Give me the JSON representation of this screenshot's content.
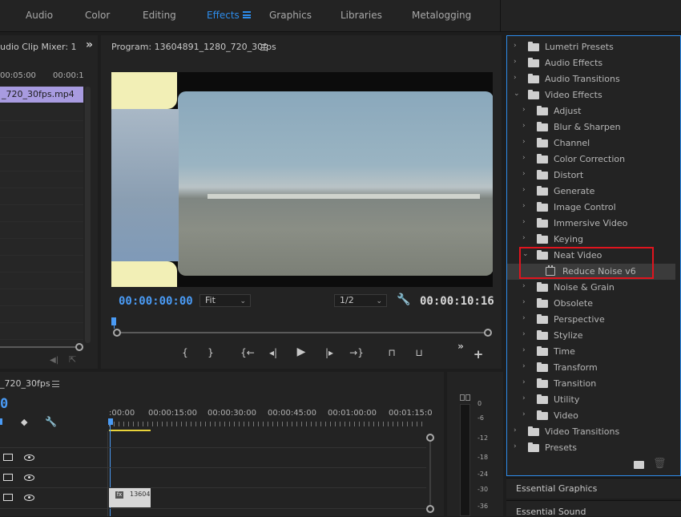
{
  "workspaces": {
    "audio": "Audio",
    "color": "Color",
    "editing": "Editing",
    "effects": "Effects",
    "graphics": "Graphics",
    "libraries": "Libraries",
    "metalogging": "Metalogging"
  },
  "audio_mixer": {
    "title": "udio Clip Mixer: 1",
    "expand_glyph": "»",
    "ruler": [
      "00:05:00",
      "00:00:1"
    ],
    "clip_label": "_720_30fps.mp4"
  },
  "program_monitor": {
    "title": "Program: 13604891_1280_720_30fps",
    "current_timecode": "00:00:00:00",
    "fit_label": "Fit",
    "resolution_label": "1/2",
    "duration_timecode": "00:00:10:16",
    "transport": {
      "mark_in": "{",
      "mark_out": "}",
      "go_to_in": "{←",
      "step_back": "◂|",
      "play": "▶",
      "step_forward": "|▸",
      "go_to_out": "→}",
      "lift": "⊓",
      "extract": "⊔",
      "more": "»",
      "add": "+"
    }
  },
  "timeline": {
    "title": "_720_30fps",
    "timecode_fragment": "0",
    "ruler": [
      ":00:00",
      "00:00:15:00",
      "00:00:30:00",
      "00:00:45:00",
      "00:01:00:00",
      "00:01:15:0"
    ],
    "clip_label": "13604"
  },
  "audio_meter": {
    "labels": [
      "0",
      "-6",
      "-12",
      "-18",
      "-24",
      "-30",
      "-36"
    ]
  },
  "effects_panel": {
    "items": [
      {
        "label": "Lumetri Presets",
        "level": 0,
        "expanded": false,
        "preset": true
      },
      {
        "label": "Audio Effects",
        "level": 0,
        "expanded": false
      },
      {
        "label": "Audio Transitions",
        "level": 0,
        "expanded": false
      },
      {
        "label": "Video Effects",
        "level": 0,
        "expanded": true
      },
      {
        "label": "Adjust",
        "level": 1,
        "expanded": false
      },
      {
        "label": "Blur & Sharpen",
        "level": 1,
        "expanded": false
      },
      {
        "label": "Channel",
        "level": 1,
        "expanded": false
      },
      {
        "label": "Color Correction",
        "level": 1,
        "expanded": false
      },
      {
        "label": "Distort",
        "level": 1,
        "expanded": false
      },
      {
        "label": "Generate",
        "level": 1,
        "expanded": false
      },
      {
        "label": "Image Control",
        "level": 1,
        "expanded": false
      },
      {
        "label": "Immersive Video",
        "level": 1,
        "expanded": false
      },
      {
        "label": "Keying",
        "level": 1,
        "expanded": false
      },
      {
        "label": "Neat Video",
        "level": 1,
        "expanded": true
      },
      {
        "label": "Reduce Noise v6",
        "level": 2,
        "effect": true,
        "selected": true
      },
      {
        "label": "Noise & Grain",
        "level": 1,
        "expanded": false
      },
      {
        "label": "Obsolete",
        "level": 1,
        "expanded": false
      },
      {
        "label": "Perspective",
        "level": 1,
        "expanded": false
      },
      {
        "label": "Stylize",
        "level": 1,
        "expanded": false
      },
      {
        "label": "Time",
        "level": 1,
        "expanded": false
      },
      {
        "label": "Transform",
        "level": 1,
        "expanded": false
      },
      {
        "label": "Transition",
        "level": 1,
        "expanded": false
      },
      {
        "label": "Utility",
        "level": 1,
        "expanded": false
      },
      {
        "label": "Video",
        "level": 1,
        "expanded": false
      },
      {
        "label": "Video Transitions",
        "level": 0,
        "expanded": false
      },
      {
        "label": "Presets",
        "level": 0,
        "expanded": false,
        "preset": true
      }
    ]
  },
  "side_panels": {
    "essential_graphics": "Essential Graphics",
    "essential_sound": "Essential Sound"
  },
  "colors": {
    "accent": "#2d8ceb",
    "highlight_box": "#e0141e",
    "clip_purple": "#a89be0",
    "playhead_blue": "#4a9bf5",
    "work_area_yellow": "#e8d33a"
  }
}
